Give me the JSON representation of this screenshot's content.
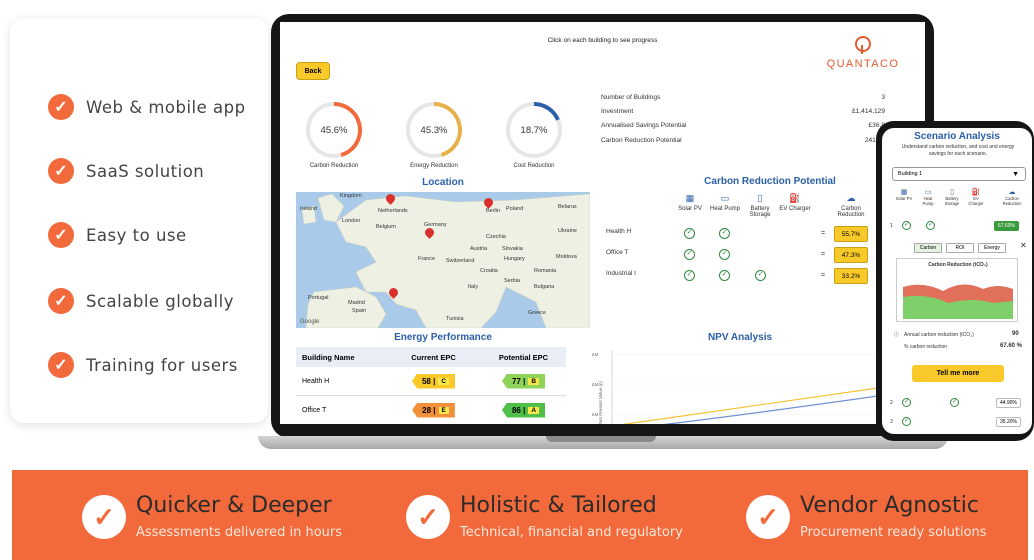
{
  "features": [
    "Web & mobile app",
    "SaaS solution",
    "Easy to use",
    "Scalable  globally",
    "Training  for users"
  ],
  "dashboard": {
    "hint": "Click on each building to see progress",
    "back_label": "Back",
    "brand": "QUANTACO",
    "gauges": [
      {
        "value": "45.6%",
        "label": "Carbon Reduction",
        "fraction": 0.456,
        "color": "#f26a3b"
      },
      {
        "value": "45.3%",
        "label": "Energy Reduction",
        "fraction": 0.453,
        "color": "#e8b04a"
      },
      {
        "value": "18.7%",
        "label": "Cost Reduction",
        "fraction": 0.187,
        "color": "#2b5fa8"
      }
    ],
    "stats": [
      {
        "label": "Number of Buildings",
        "value": "3"
      },
      {
        "label": "Investment",
        "value": "£1,414,129"
      },
      {
        "label": "Annualised Savings Potential",
        "value": "£36,8"
      },
      {
        "label": "Carbon Reduction Potential",
        "value": "241.0 t"
      }
    ],
    "location_title": "Location",
    "map_labels": [
      "Kingdom",
      "Ireland",
      "Netherlands",
      "Berlin",
      "Poland",
      "Belarus",
      "London",
      "Belgium",
      "Germany",
      "Czechia",
      "Slovakia",
      "Ukraine",
      "France",
      "Austria",
      "Hungary",
      "Moldova",
      "Switzerland",
      "Croatia",
      "Romania",
      "Italy",
      "Serbia",
      "Bulgaria",
      "Portugal",
      "Madrid",
      "Spain",
      "Tunisia",
      "Greece"
    ],
    "google": "Google",
    "energy_title": "Energy Performance",
    "epc_headers": [
      "Building Name",
      "Current EPC",
      "Potential EPC"
    ],
    "epc_rows": [
      {
        "name": "Health H",
        "current": "58 |",
        "current_letter": "C",
        "current_color": "#f9c929",
        "potential": "77 |",
        "potential_letter": "B",
        "potential_color": "#8fd45a"
      },
      {
        "name": "Office T",
        "current": "28 |",
        "current_letter": "E",
        "current_color": "#f2913a",
        "potential": "86 |",
        "potential_letter": "A",
        "potential_color": "#4fbf4a"
      }
    ],
    "crp_title": "Carbon Reduction Potential",
    "crp_columns": [
      {
        "icon": "solar-panel-icon",
        "glyph": "▦",
        "label": "Solar PV"
      },
      {
        "icon": "heat-pump-icon",
        "glyph": "▭",
        "label": "Heat Pump"
      },
      {
        "icon": "battery-icon",
        "glyph": "▯",
        "label": "Battery Storage"
      },
      {
        "icon": "ev-charger-icon",
        "glyph": "⛽",
        "label": "EV Charger"
      },
      {
        "icon": "carbon-cloud-icon",
        "glyph": "☁",
        "label": "Carbon Reduction"
      }
    ],
    "crp_rows": [
      {
        "name": "Health H",
        "pct": "55.7%"
      },
      {
        "name": "Office T",
        "pct": "47.3%"
      },
      {
        "name": "Industrial I",
        "pct": "33.2%"
      }
    ],
    "npv_title": "NPV Analysis",
    "npv_ylabel": "Net Present Value (£)",
    "npv_ticks": [
      "£M",
      "£M",
      "£M"
    ]
  },
  "phone": {
    "title": "Scenario Analysis",
    "subtitle": "Understand carbon reduction, and cost and energy savings for each scenario.",
    "select_value": "Building 1",
    "tech": [
      "Solar PV",
      "Heat Pump",
      "Battery Storage",
      "EV Charger",
      "Carbon Reduction"
    ],
    "row1_num": "1",
    "row1_pct": "67.60%",
    "tabs": [
      "Carbon",
      "ROI",
      "Energy"
    ],
    "close": "✕",
    "chart_title": "Carbon Reduction (tCO₂)",
    "annual_label": "Annual carbon reduction (tCO₂)",
    "annual_value": "90",
    "pct_label": "% carbon reduction",
    "pct_value": "67.60 %",
    "tell_more": "Tell me more",
    "row2_num": "2",
    "row2_pct": "44.90%",
    "row3_num": "3",
    "row3_pct": "35.20%"
  },
  "banner": [
    {
      "title": "Quicker & Deeper",
      "subtitle": "Assessments delivered in hours"
    },
    {
      "title": "Holistic & Tailored",
      "subtitle": "Technical, financial and regulatory"
    },
    {
      "title": "Vendor Agnostic",
      "subtitle": "Procurement ready solutions"
    }
  ],
  "colors": {
    "accent": "#f26a3b",
    "brand_blue": "#2b5fa8",
    "yellow": "#f9c929",
    "check_green": "#2b8a3e"
  }
}
